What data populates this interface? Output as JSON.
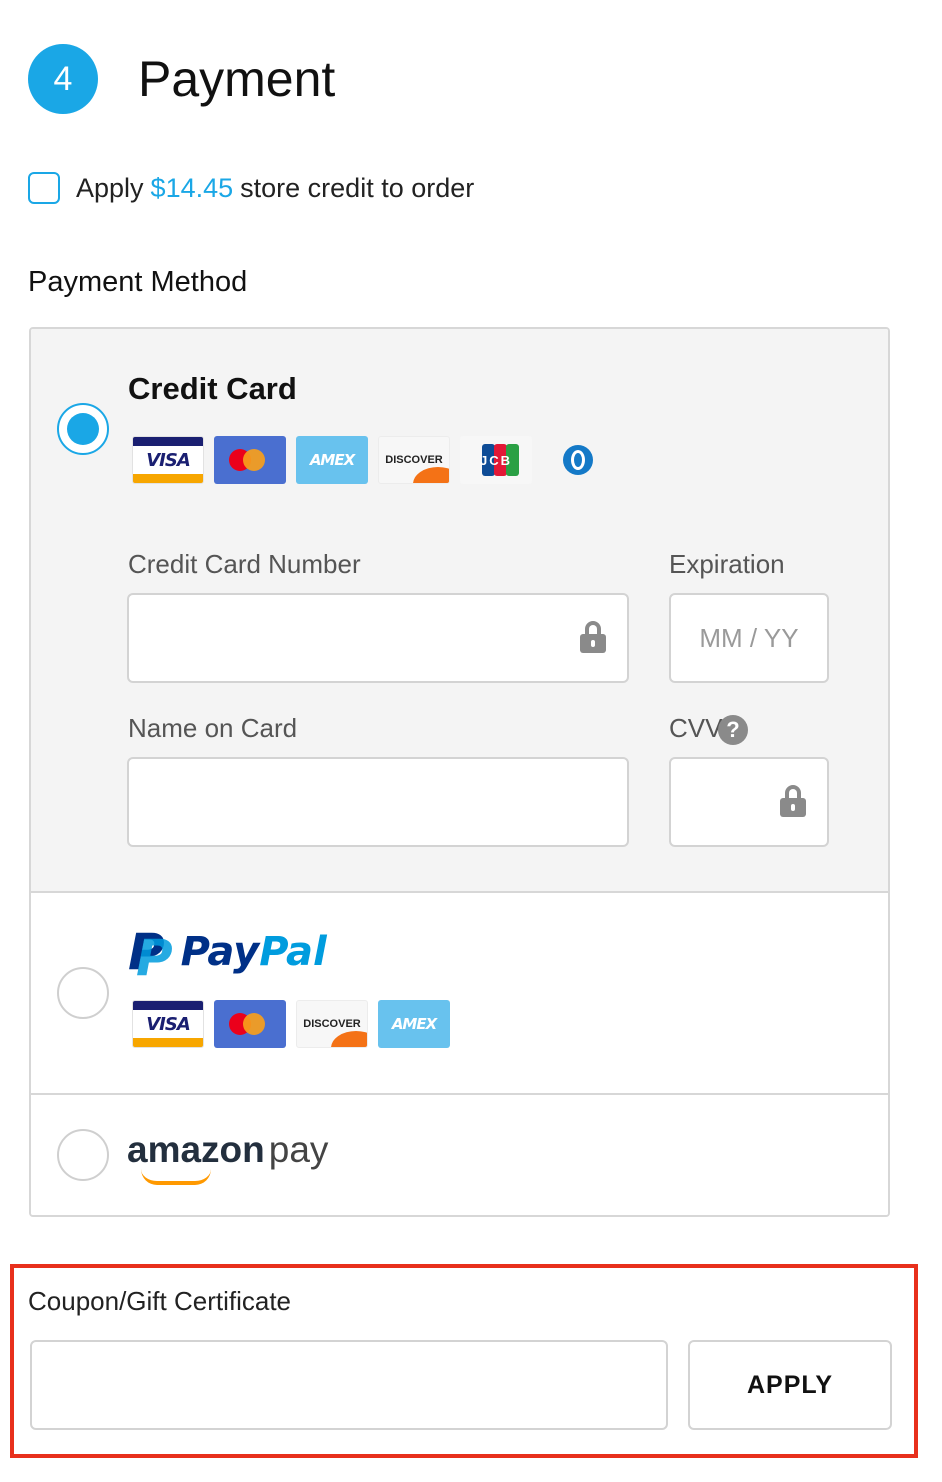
{
  "step": {
    "number": "4",
    "title": "Payment"
  },
  "store_credit": {
    "prefix": "Apply",
    "amount": "$14.45",
    "suffix": "store credit to order",
    "checked": false
  },
  "payment_method": {
    "heading": "Payment Method",
    "credit_card": {
      "title": "Credit Card",
      "selected": true,
      "card_logos": [
        "VISA",
        "AMEX",
        "DISCOVER",
        "JCB"
      ],
      "fields": {
        "number_label": "Credit Card Number",
        "number_value": "",
        "expiration_label": "Expiration",
        "expiration_placeholder": "MM / YY",
        "name_label": "Name on Card",
        "name_value": "",
        "cvv_label": "CVV",
        "cvv_help": "?"
      }
    },
    "paypal": {
      "selected": false,
      "wordmark_pay": "Pay",
      "wordmark_pal": "Pal",
      "card_logos": [
        "VISA",
        "DISCOVER",
        "AMEX"
      ]
    },
    "amazon_pay": {
      "selected": false,
      "wordmark_amazon": "amazon",
      "wordmark_pay": "pay"
    }
  },
  "coupon": {
    "label": "Coupon/Gift Certificate",
    "value": "",
    "apply_label": "APPLY"
  },
  "colors": {
    "accent": "#1aa7e6",
    "highlight_border": "#e8301c",
    "panel_bg": "#f4f4f4",
    "border": "#d7d7d7"
  }
}
